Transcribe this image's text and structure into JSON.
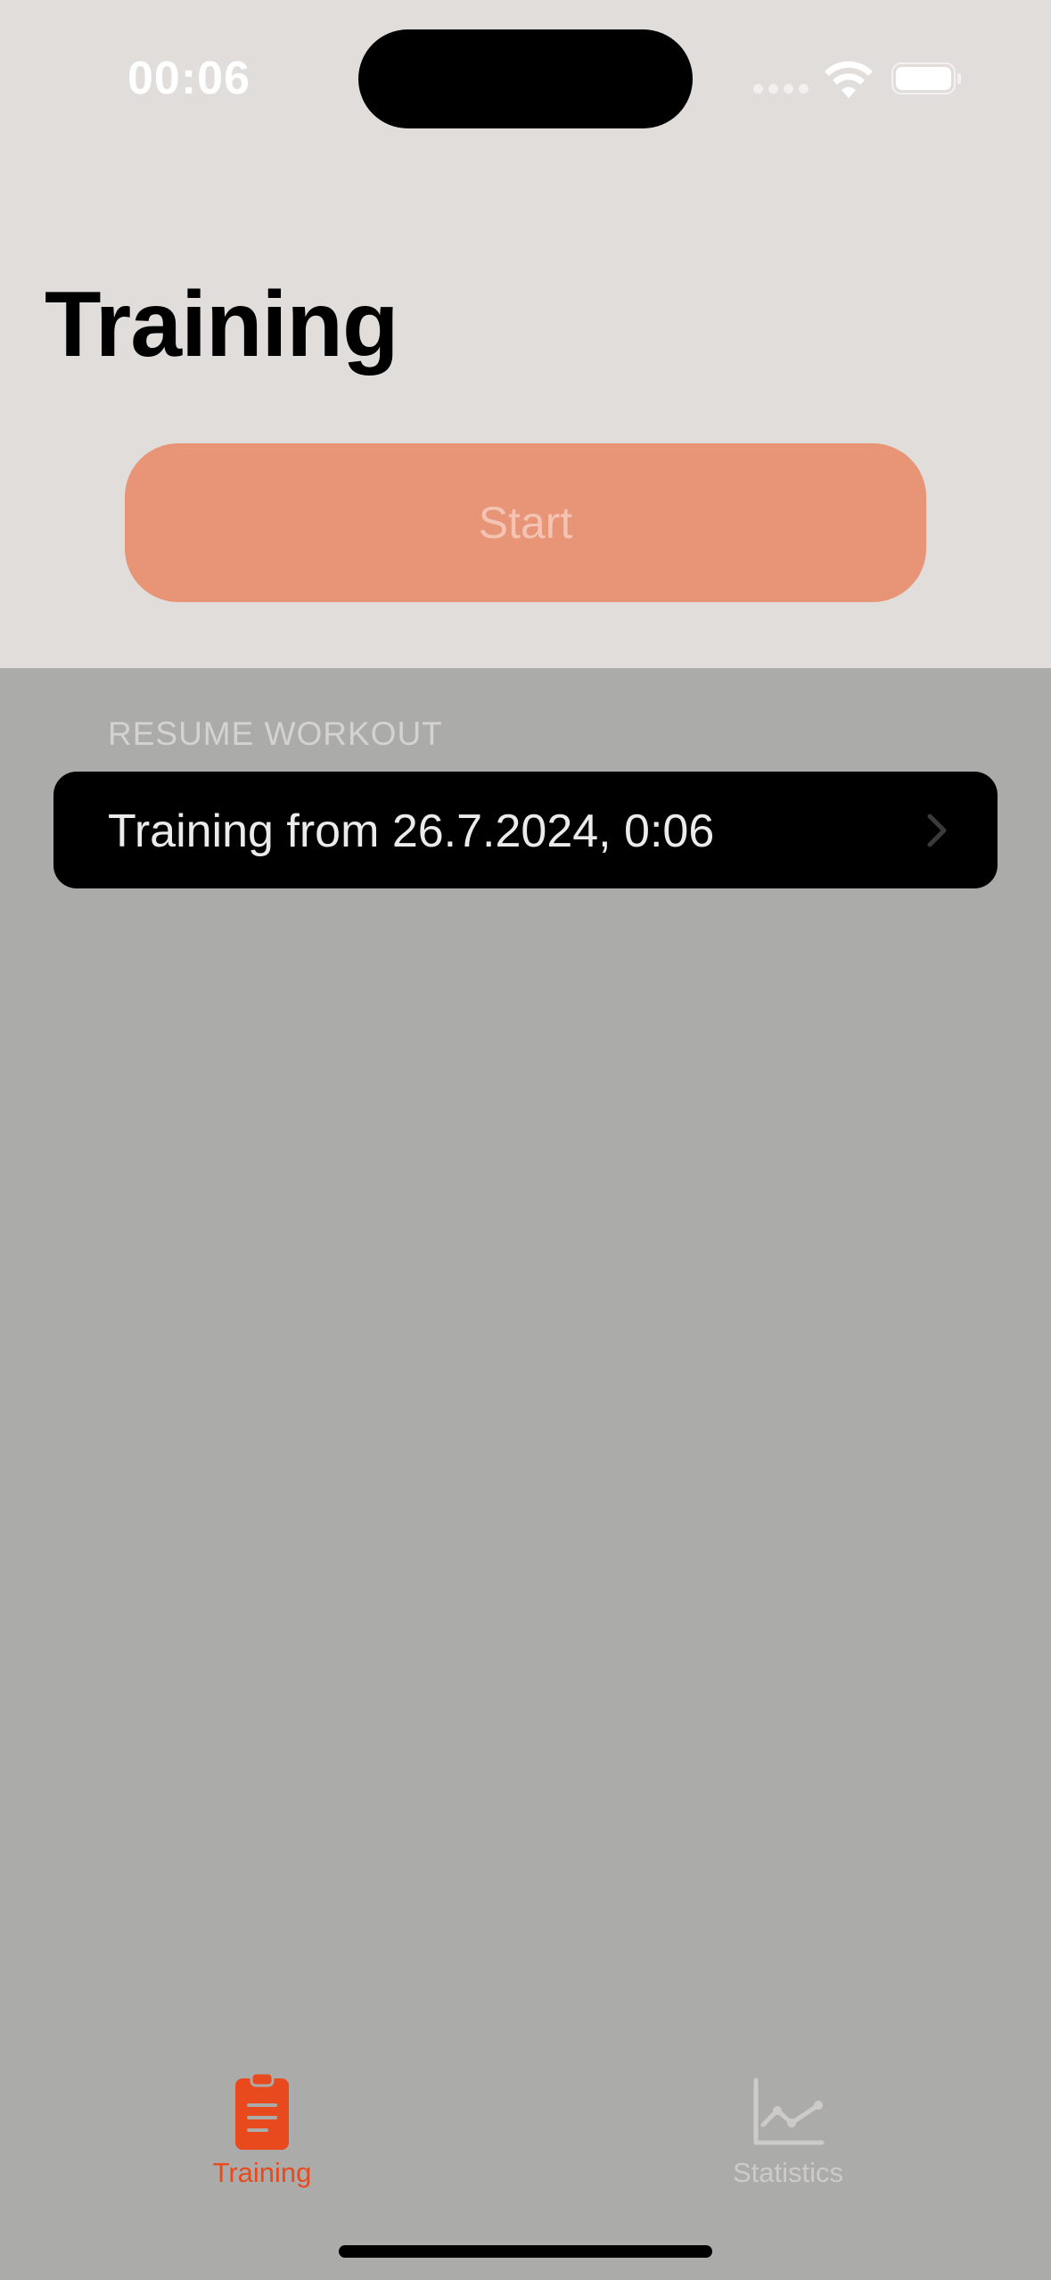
{
  "status_bar": {
    "time": "00:06",
    "icons": [
      "signal-icon",
      "wifi-icon",
      "battery-icon"
    ]
  },
  "header": {
    "title": "Training"
  },
  "start_button": {
    "label": "Start"
  },
  "resume_section": {
    "header": "RESUME WORKOUT",
    "items": [
      {
        "label": "Training from 26.7.2024, 0:06",
        "icon": "chevron-right-icon"
      }
    ]
  },
  "tab_bar": {
    "tabs": [
      {
        "label": "Training",
        "icon": "clipboard-icon",
        "selected": true
      },
      {
        "label": "Statistics",
        "icon": "chart-line-icon",
        "selected": false
      }
    ]
  },
  "colors": {
    "accent": "#e94a1d",
    "start_button_bg": "#e89476",
    "top_bg": "#e1dddb",
    "dimmed_bg": "#ababaa"
  }
}
